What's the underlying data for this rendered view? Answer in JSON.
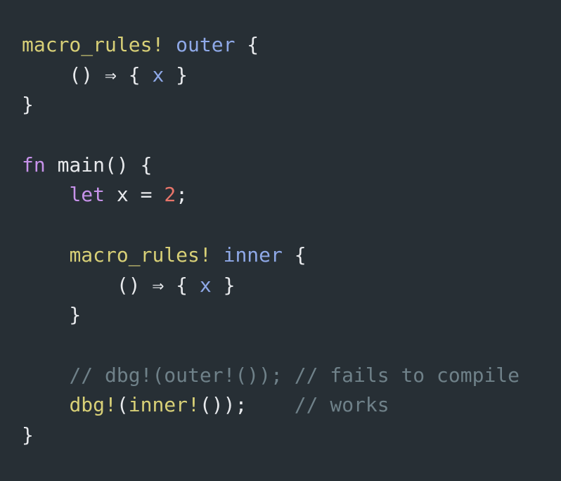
{
  "editor": {
    "language": "rust",
    "background_color": "#272f35",
    "foreground_color": "#e8eaed",
    "font_size_px": 28,
    "line_height_px": 42.7,
    "colors": {
      "macro": "#d8d077",
      "macro_name": "#8fa9e8",
      "keyword": "#c792ea",
      "number": "#e8756a",
      "comment": "#6f8189",
      "punctuation": "#e8eaed",
      "variable": "#8fa9e8"
    }
  },
  "code": {
    "lines": [
      {
        "index": 0,
        "text": "macro_rules! outer {",
        "tokens": [
          {
            "t": "macro_rules!",
            "c": "tok-macro"
          },
          {
            "t": " ",
            "c": "tok-punct"
          },
          {
            "t": "outer",
            "c": "tok-name"
          },
          {
            "t": " {",
            "c": "tok-punct"
          }
        ]
      },
      {
        "index": 1,
        "text": "    () ⇒ { x }",
        "tokens": [
          {
            "t": "    () ",
            "c": "tok-punct"
          },
          {
            "t": "⇒",
            "c": "tok-punct"
          },
          {
            "t": " { ",
            "c": "tok-punct"
          },
          {
            "t": "x",
            "c": "tok-var"
          },
          {
            "t": " }",
            "c": "tok-punct"
          }
        ]
      },
      {
        "index": 2,
        "text": "}",
        "tokens": [
          {
            "t": "}",
            "c": "tok-punct"
          }
        ]
      },
      {
        "index": 3,
        "text": "",
        "tokens": []
      },
      {
        "index": 4,
        "text": "fn main() {",
        "tokens": [
          {
            "t": "fn",
            "c": "tok-keyword"
          },
          {
            "t": " ",
            "c": "tok-punct"
          },
          {
            "t": "main",
            "c": "tok-ident"
          },
          {
            "t": "() {",
            "c": "tok-punct"
          }
        ]
      },
      {
        "index": 5,
        "text": "    let x = 2;",
        "tokens": [
          {
            "t": "    ",
            "c": "tok-punct"
          },
          {
            "t": "let",
            "c": "tok-keyword"
          },
          {
            "t": " x = ",
            "c": "tok-punct"
          },
          {
            "t": "2",
            "c": "tok-number"
          },
          {
            "t": ";",
            "c": "tok-punct"
          }
        ]
      },
      {
        "index": 6,
        "text": "",
        "tokens": []
      },
      {
        "index": 7,
        "text": "    macro_rules! inner {",
        "tokens": [
          {
            "t": "    ",
            "c": "tok-punct"
          },
          {
            "t": "macro_rules!",
            "c": "tok-macro"
          },
          {
            "t": " ",
            "c": "tok-punct"
          },
          {
            "t": "inner",
            "c": "tok-name"
          },
          {
            "t": " {",
            "c": "tok-punct"
          }
        ]
      },
      {
        "index": 8,
        "text": "        () ⇒ { x }",
        "tokens": [
          {
            "t": "        () ",
            "c": "tok-punct"
          },
          {
            "t": "⇒",
            "c": "tok-punct"
          },
          {
            "t": " { ",
            "c": "tok-punct"
          },
          {
            "t": "x",
            "c": "tok-var"
          },
          {
            "t": " }",
            "c": "tok-punct"
          }
        ]
      },
      {
        "index": 9,
        "text": "    }",
        "tokens": [
          {
            "t": "    }",
            "c": "tok-punct"
          }
        ]
      },
      {
        "index": 10,
        "text": "",
        "tokens": []
      },
      {
        "index": 11,
        "text": "    // dbg!(outer!()); // fails to compile",
        "tokens": [
          {
            "t": "    ",
            "c": "tok-punct"
          },
          {
            "t": "// dbg!(outer!()); // fails to compile",
            "c": "tok-comment"
          }
        ]
      },
      {
        "index": 12,
        "text": "    dbg!(inner!());    // works",
        "tokens": [
          {
            "t": "    ",
            "c": "tok-punct"
          },
          {
            "t": "dbg!",
            "c": "tok-macro"
          },
          {
            "t": "(",
            "c": "tok-punct"
          },
          {
            "t": "inner!",
            "c": "tok-macro"
          },
          {
            "t": "());",
            "c": "tok-punct"
          },
          {
            "t": "    ",
            "c": "tok-punct"
          },
          {
            "t": "// works",
            "c": "tok-comment"
          }
        ]
      },
      {
        "index": 13,
        "text": "}",
        "tokens": [
          {
            "t": "}",
            "c": "tok-punct"
          }
        ]
      }
    ]
  }
}
